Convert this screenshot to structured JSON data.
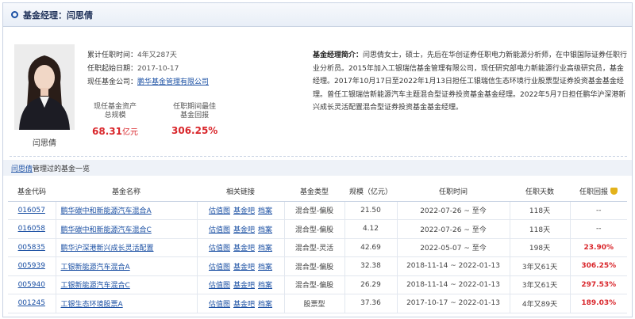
{
  "header": {
    "title": "基金经理：闫思倩"
  },
  "manager": {
    "name": "闫思倩",
    "tenure_label": "累计任职时间：",
    "tenure_value": "4年又287天",
    "start_label": "任职起始日期：",
    "start_value": "2017-10-17",
    "company_label": "现任基金公司：",
    "company_value": "鹏华基金管理有限公司"
  },
  "stats": {
    "assets_label_1": "现任基金资产",
    "assets_label_2": "总规模",
    "assets_value": "68.31",
    "assets_unit": "亿元",
    "return_label_1": "任职期间最佳",
    "return_label_2": "基金回报",
    "return_value": "306.25%"
  },
  "bio": {
    "label": "基金经理简介：",
    "text": "闫思倩女士，硕士，先后在华创证券任职电力新能源分析师，在中银国际证券任职行业分析员。2015年加入工银瑞信基金管理有限公司，现任研究部电力新能源行业高级研究员，基金经理。2017年10月17日至2022年1月13日担任工银瑞信生态环境行业股票型证券投资基金基金经理。曾任工银瑞信新能源汽车主题混合型证券投资基金基金经理。2022年5月7日担任鹏华沪深港新兴成长灵活配置混合型证券投资基金基金经理。"
  },
  "table_section": {
    "manager_link": "闫思倩",
    "suffix": "管理过的基金一览"
  },
  "table": {
    "headers": [
      "基金代码",
      "基金名称",
      "相关链接",
      "基金类型",
      "规模（亿元）",
      "任职时间",
      "任职天数",
      "任职回报"
    ],
    "link_labels": [
      "估值图",
      "基金吧",
      "档案"
    ],
    "rows": [
      {
        "code": "016057",
        "name": "鹏华碳中和新能源汽车混合A",
        "type": "混合型-偏股",
        "scale": "21.50",
        "period": "2022-07-26 ~ 至今",
        "days": "118天",
        "ret": "--"
      },
      {
        "code": "016058",
        "name": "鹏华碳中和新能源汽车混合C",
        "type": "混合型-偏股",
        "scale": "4.12",
        "period": "2022-07-26 ~ 至今",
        "days": "118天",
        "ret": "--"
      },
      {
        "code": "005835",
        "name": "鹏华沪深港新兴成长灵活配置",
        "type": "混合型-灵活",
        "scale": "42.69",
        "period": "2022-05-07 ~ 至今",
        "days": "198天",
        "ret": "23.90%"
      },
      {
        "code": "005939",
        "name": "工银新能源汽车混合A",
        "type": "混合型-偏股",
        "scale": "32.38",
        "period": "2018-11-14 ~ 2022-01-13",
        "days": "3年又61天",
        "ret": "306.25%"
      },
      {
        "code": "005940",
        "name": "工银新能源汽车混合C",
        "type": "混合型-偏股",
        "scale": "26.29",
        "period": "2018-11-14 ~ 2022-01-13",
        "days": "3年又61天",
        "ret": "297.53%"
      },
      {
        "code": "001245",
        "name": "工银生态环境股票A",
        "type": "股票型",
        "scale": "37.36",
        "period": "2017-10-17 ~ 2022-01-13",
        "days": "4年又89天",
        "ret": "189.03%"
      }
    ]
  },
  "colors": {
    "accent": "#1a4fa3",
    "highlight_red": "#d9262b",
    "header_bg": "#e8eef7",
    "border": "#c9d3e3"
  },
  "icons": {
    "header": "circle-bullet-icon",
    "return_header": "trophy-icon"
  }
}
